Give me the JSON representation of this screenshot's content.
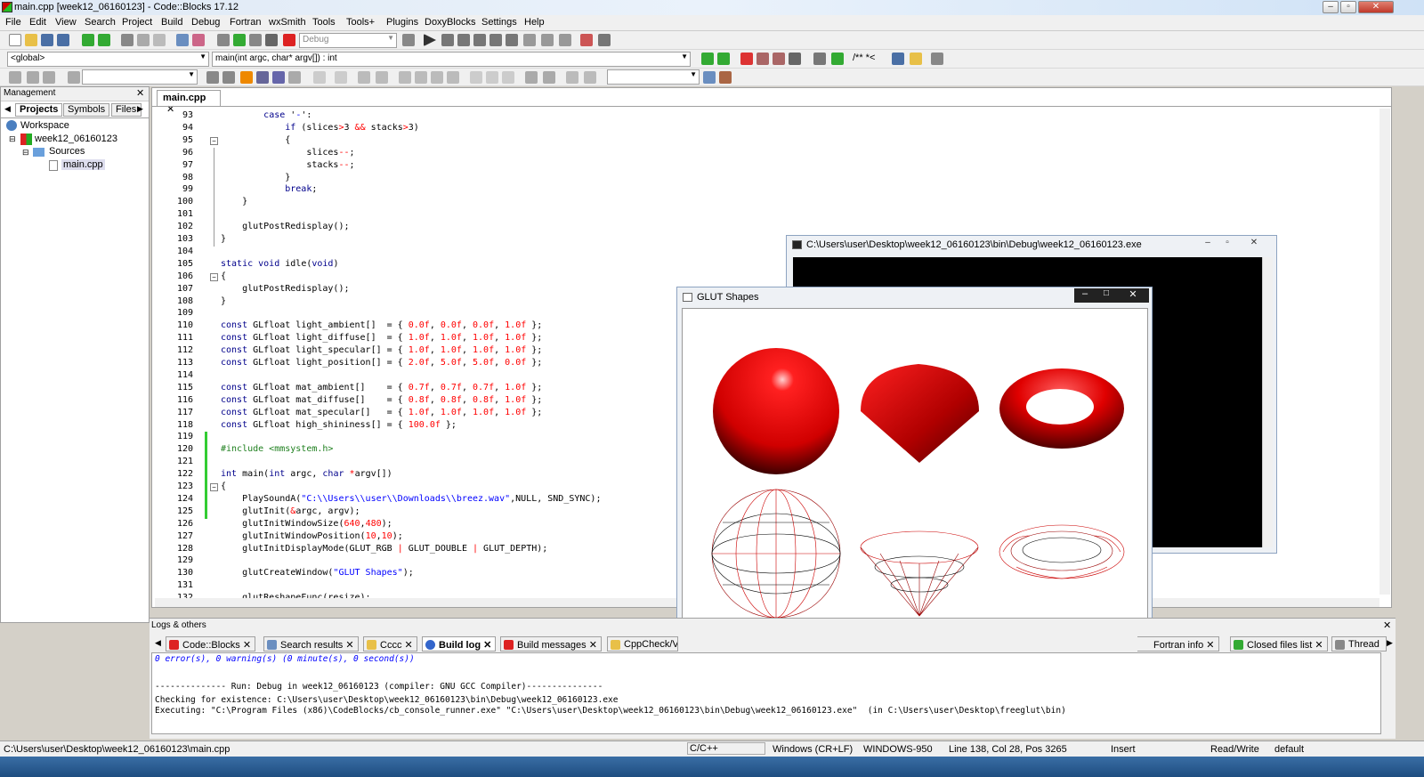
{
  "window": {
    "title": "main.cpp [week12_06160123] - Code::Blocks 17.12"
  },
  "menu": [
    "File",
    "Edit",
    "View",
    "Search",
    "Project",
    "Build",
    "Debug",
    "Fortran",
    "wxSmith",
    "Tools",
    "Tools+",
    "Plugins",
    "DoxyBlocks",
    "Settings",
    "Help"
  ],
  "toolbar": {
    "build_target": "Debug",
    "scope": "<global>",
    "function": "main(int argc, char* argv[]) : int",
    "doxy_label": "/** *<"
  },
  "management": {
    "title": "Management",
    "tabs": [
      "Projects",
      "Symbols",
      "Files"
    ],
    "tree": [
      "Workspace",
      "week12_06160123",
      "Sources",
      "main.cpp"
    ]
  },
  "editor": {
    "tab": "main.cpp",
    "lines": [
      {
        "n": "93",
        "code": [
          [
            "        ",
            ""
          ],
          [
            "case",
            "kw"
          ],
          [
            " '",
            ""
          ],
          [
            "-",
            "str"
          ],
          [
            "':",
            ""
          ]
        ]
      },
      {
        "n": "94",
        "code": [
          [
            "            ",
            ""
          ],
          [
            "if",
            "kw"
          ],
          [
            " (slices",
            ""
          ],
          [
            ">",
            "op"
          ],
          [
            "3 ",
            ""
          ],
          [
            "&&",
            "op"
          ],
          [
            " stacks",
            ""
          ],
          [
            ">",
            "op"
          ],
          [
            "3)",
            ""
          ]
        ]
      },
      {
        "n": "95",
        "code": [
          [
            "            {",
            ""
          ]
        ]
      },
      {
        "n": "96",
        "code": [
          [
            "                slices",
            ""
          ],
          [
            "--",
            "op"
          ],
          [
            ";",
            ""
          ]
        ]
      },
      {
        "n": "97",
        "code": [
          [
            "                stacks",
            ""
          ],
          [
            "--",
            "op"
          ],
          [
            ";",
            ""
          ]
        ]
      },
      {
        "n": "98",
        "code": [
          [
            "            }",
            ""
          ]
        ]
      },
      {
        "n": "99",
        "code": [
          [
            "            ",
            ""
          ],
          [
            "break",
            "kw"
          ],
          [
            ";",
            ""
          ]
        ]
      },
      {
        "n": "100",
        "code": [
          [
            "    }",
            ""
          ]
        ]
      },
      {
        "n": "101",
        "code": [
          [
            "",
            ""
          ]
        ]
      },
      {
        "n": "102",
        "code": [
          [
            "    glutPostRedisplay();",
            ""
          ]
        ]
      },
      {
        "n": "103",
        "code": [
          [
            "}",
            ""
          ]
        ]
      },
      {
        "n": "104",
        "code": [
          [
            "",
            ""
          ]
        ]
      },
      {
        "n": "105",
        "code": [
          [
            "static void",
            "kw"
          ],
          [
            " idle(",
            ""
          ],
          [
            "void",
            "kw"
          ],
          [
            ")",
            ""
          ]
        ]
      },
      {
        "n": "106",
        "code": [
          [
            "{",
            ""
          ]
        ]
      },
      {
        "n": "107",
        "code": [
          [
            "    glutPostRedisplay();",
            ""
          ]
        ]
      },
      {
        "n": "108",
        "code": [
          [
            "}",
            ""
          ]
        ]
      },
      {
        "n": "109",
        "code": [
          [
            "",
            ""
          ]
        ]
      },
      {
        "n": "110",
        "code": [
          [
            "const",
            "kw"
          ],
          [
            " GLfloat light_ambient[]  = { ",
            ""
          ],
          [
            "0.0f",
            "num"
          ],
          [
            ", ",
            ""
          ],
          [
            "0.0f",
            "num"
          ],
          [
            ", ",
            ""
          ],
          [
            "0.0f",
            "num"
          ],
          [
            ", ",
            ""
          ],
          [
            "1.0f",
            "num"
          ],
          [
            " };",
            ""
          ]
        ]
      },
      {
        "n": "111",
        "code": [
          [
            "const",
            "kw"
          ],
          [
            " GLfloat light_diffuse[]  = { ",
            ""
          ],
          [
            "1.0f",
            "num"
          ],
          [
            ", ",
            ""
          ],
          [
            "1.0f",
            "num"
          ],
          [
            ", ",
            ""
          ],
          [
            "1.0f",
            "num"
          ],
          [
            ", ",
            ""
          ],
          [
            "1.0f",
            "num"
          ],
          [
            " };",
            ""
          ]
        ]
      },
      {
        "n": "112",
        "code": [
          [
            "const",
            "kw"
          ],
          [
            " GLfloat light_specular[] = { ",
            ""
          ],
          [
            "1.0f",
            "num"
          ],
          [
            ", ",
            ""
          ],
          [
            "1.0f",
            "num"
          ],
          [
            ", ",
            ""
          ],
          [
            "1.0f",
            "num"
          ],
          [
            ", ",
            ""
          ],
          [
            "1.0f",
            "num"
          ],
          [
            " };",
            ""
          ]
        ]
      },
      {
        "n": "113",
        "code": [
          [
            "const",
            "kw"
          ],
          [
            " GLfloat light_position[] = { ",
            ""
          ],
          [
            "2.0f",
            "num"
          ],
          [
            ", ",
            ""
          ],
          [
            "5.0f",
            "num"
          ],
          [
            ", ",
            ""
          ],
          [
            "5.0f",
            "num"
          ],
          [
            ", ",
            ""
          ],
          [
            "0.0f",
            "num"
          ],
          [
            " };",
            ""
          ]
        ]
      },
      {
        "n": "114",
        "code": [
          [
            "",
            ""
          ]
        ]
      },
      {
        "n": "115",
        "code": [
          [
            "const",
            "kw"
          ],
          [
            " GLfloat mat_ambient[]    = { ",
            ""
          ],
          [
            "0.7f",
            "num"
          ],
          [
            ", ",
            ""
          ],
          [
            "0.7f",
            "num"
          ],
          [
            ", ",
            ""
          ],
          [
            "0.7f",
            "num"
          ],
          [
            ", ",
            ""
          ],
          [
            "1.0f",
            "num"
          ],
          [
            " };",
            ""
          ]
        ]
      },
      {
        "n": "116",
        "code": [
          [
            "const",
            "kw"
          ],
          [
            " GLfloat mat_diffuse[]    = { ",
            ""
          ],
          [
            "0.8f",
            "num"
          ],
          [
            ", ",
            ""
          ],
          [
            "0.8f",
            "num"
          ],
          [
            ", ",
            ""
          ],
          [
            "0.8f",
            "num"
          ],
          [
            ", ",
            ""
          ],
          [
            "1.0f",
            "num"
          ],
          [
            " };",
            ""
          ]
        ]
      },
      {
        "n": "117",
        "code": [
          [
            "const",
            "kw"
          ],
          [
            " GLfloat mat_specular[]   = { ",
            ""
          ],
          [
            "1.0f",
            "num"
          ],
          [
            ", ",
            ""
          ],
          [
            "1.0f",
            "num"
          ],
          [
            ", ",
            ""
          ],
          [
            "1.0f",
            "num"
          ],
          [
            ", ",
            ""
          ],
          [
            "1.0f",
            "num"
          ],
          [
            " };",
            ""
          ]
        ]
      },
      {
        "n": "118",
        "code": [
          [
            "const",
            "kw"
          ],
          [
            " GLfloat high_shininess[] = { ",
            ""
          ],
          [
            "100.0f",
            "num"
          ],
          [
            " };",
            ""
          ]
        ]
      },
      {
        "n": "119",
        "code": [
          [
            "",
            ""
          ]
        ]
      },
      {
        "n": "120",
        "code": [
          [
            "#include <mmsystem.h>",
            "pp"
          ]
        ]
      },
      {
        "n": "121",
        "code": [
          [
            "",
            ""
          ]
        ]
      },
      {
        "n": "122",
        "code": [
          [
            "int",
            "kw"
          ],
          [
            " main(",
            ""
          ],
          [
            "int",
            "kw"
          ],
          [
            " argc, ",
            ""
          ],
          [
            "char",
            "kw"
          ],
          [
            " ",
            ""
          ],
          [
            "*",
            "op"
          ],
          [
            "argv[])",
            ""
          ]
        ]
      },
      {
        "n": "123",
        "code": [
          [
            "{",
            ""
          ]
        ]
      },
      {
        "n": "124",
        "code": [
          [
            "    PlaySoundA(",
            ""
          ],
          [
            "\"C:\\\\Users\\\\user\\\\Downloads\\\\breez.wav\"",
            "str"
          ],
          [
            ",NULL, SND_SYNC);",
            ""
          ]
        ]
      },
      {
        "n": "125",
        "code": [
          [
            "    glutInit(",
            ""
          ],
          [
            "&",
            "op"
          ],
          [
            "argc, argv);",
            ""
          ]
        ]
      },
      {
        "n": "126",
        "code": [
          [
            "    glutInitWindowSize(",
            ""
          ],
          [
            "640",
            "num"
          ],
          [
            ",",
            ""
          ],
          [
            "480",
            "num"
          ],
          [
            ");",
            ""
          ]
        ]
      },
      {
        "n": "127",
        "code": [
          [
            "    glutInitWindowPosition(",
            ""
          ],
          [
            "10",
            "num"
          ],
          [
            ",",
            ""
          ],
          [
            "10",
            "num"
          ],
          [
            ");",
            ""
          ]
        ]
      },
      {
        "n": "128",
        "code": [
          [
            "    glutInitDisplayMode(GLUT_RGB ",
            ""
          ],
          [
            "|",
            "op"
          ],
          [
            " GLUT_DOUBLE ",
            ""
          ],
          [
            "|",
            "op"
          ],
          [
            " GLUT_DEPTH);",
            ""
          ]
        ]
      },
      {
        "n": "129",
        "code": [
          [
            "",
            ""
          ]
        ]
      },
      {
        "n": "130",
        "code": [
          [
            "    glutCreateWindow(",
            ""
          ],
          [
            "\"GLUT Shapes\"",
            "str"
          ],
          [
            ");",
            ""
          ]
        ]
      },
      {
        "n": "131",
        "code": [
          [
            "",
            ""
          ]
        ]
      },
      {
        "n": "132",
        "code": [
          [
            "    glutReshapeFunc(resize);",
            ""
          ]
        ]
      }
    ]
  },
  "console_window": {
    "title": "C:\\Users\\user\\Desktop\\week12_06160123\\bin\\Debug\\week12_06160123.exe"
  },
  "glut_window": {
    "title": "GLUT Shapes",
    "shape_color": "#cc0000"
  },
  "logs": {
    "title": "Logs & others",
    "tabs": [
      "Code::Blocks",
      "Search results",
      "Cccc",
      "Build log",
      "Build messages",
      "CppCheck/Vera",
      "Fortran info",
      "Closed files list",
      "Thread"
    ],
    "lines": [
      {
        "text": "0 error(s), 0 warning(s) (0 minute(s), 0 second(s))",
        "color": "#0000ff",
        "italic": true
      },
      {
        "text": "",
        "color": "#000"
      },
      {
        "text": "-------------- Run: Debug in week12_06160123 (compiler: GNU GCC Compiler)---------------",
        "color": "#000"
      },
      {
        "text": "Checking for existence: C:\\Users\\user\\Desktop\\week12_06160123\\bin\\Debug\\week12_06160123.exe",
        "color": "#000"
      },
      {
        "text": "Executing: \"C:\\Program Files (x86)\\CodeBlocks/cb_console_runner.exe\" \"C:\\Users\\user\\Desktop\\week12_06160123\\bin\\Debug\\week12_06160123.exe\"  (in C:\\Users\\user\\Desktop\\freeglut\\bin)",
        "color": "#000"
      }
    ]
  },
  "status": {
    "path": "C:\\Users\\user\\Desktop\\week12_06160123\\main.cpp",
    "lang": "C/C++",
    "eol": "Windows (CR+LF)",
    "encoding": "WINDOWS-950",
    "position": "Line 138, Col 28, Pos 3265",
    "mode": "Insert",
    "rw": "Read/Write",
    "profile": "default"
  }
}
